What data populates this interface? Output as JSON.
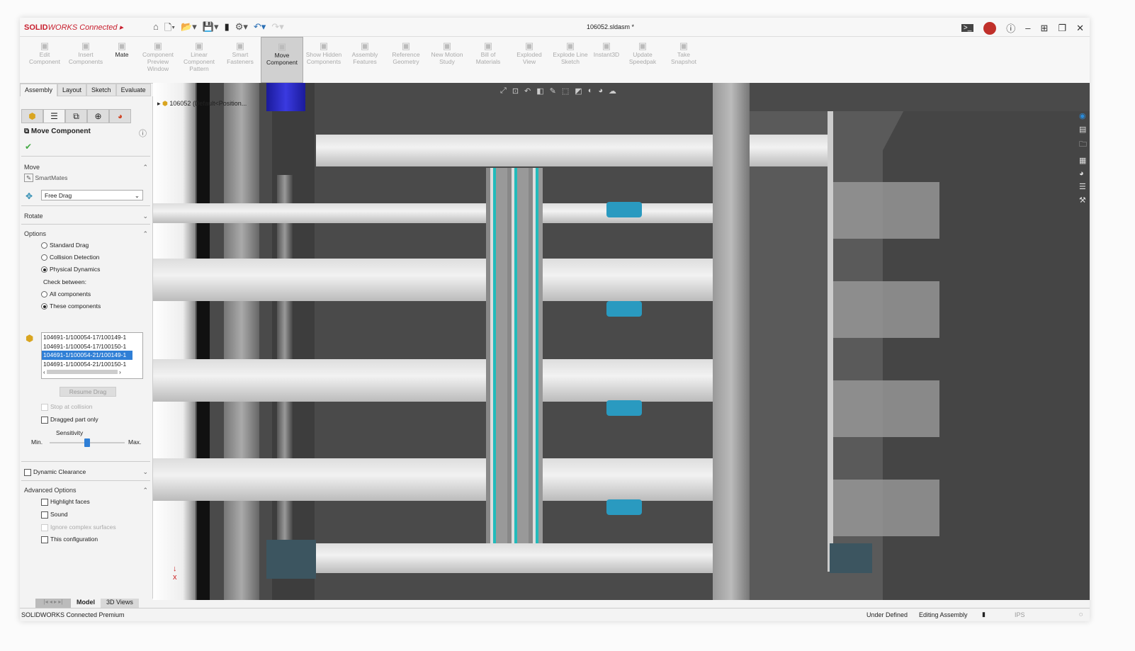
{
  "app": {
    "brand_bold": "SOLID",
    "brand_rest": "WORKS Connected",
    "document_title": "106052.sldasm *"
  },
  "quick_access": [
    "home-icon",
    "new-icon",
    "open-icon",
    "save-icon",
    "traffic-light-icon",
    "gear-icon",
    "undo-icon",
    "redo-icon"
  ],
  "ribbon": [
    {
      "label": "Edit Component",
      "state": "disabled"
    },
    {
      "label": "Insert Components",
      "state": "disabled"
    },
    {
      "label": "Mate",
      "state": "enabled"
    },
    {
      "label": "Component Preview Window",
      "state": "disabled"
    },
    {
      "label": "Linear Component Pattern",
      "state": "disabled"
    },
    {
      "label": "Smart Fasteners",
      "state": "disabled"
    },
    {
      "label": "Move Component",
      "state": "active"
    },
    {
      "label": "Show Hidden Components",
      "state": "disabled"
    },
    {
      "label": "Assembly Features",
      "state": "disabled"
    },
    {
      "label": "Reference Geometry",
      "state": "disabled"
    },
    {
      "label": "New Motion Study",
      "state": "disabled"
    },
    {
      "label": "Bill of Materials",
      "state": "disabled"
    },
    {
      "label": "Exploded View",
      "state": "disabled"
    },
    {
      "label": "Explode Line Sketch",
      "state": "disabled"
    },
    {
      "label": "Instant3D",
      "state": "disabled"
    },
    {
      "label": "Update Speedpak",
      "state": "disabled"
    },
    {
      "label": "Take Snapshot",
      "state": "disabled"
    }
  ],
  "command_tabs": [
    "Assembly",
    "Layout",
    "Sketch",
    "Evaluate"
  ],
  "property_manager": {
    "title": "Move Component",
    "move": {
      "heading": "Move",
      "smartmates": "SmartMates",
      "mode": "Free Drag"
    },
    "rotate": {
      "heading": "Rotate"
    },
    "options": {
      "heading": "Options",
      "radios": [
        "Standard Drag",
        "Collision Detection",
        "Physical Dynamics"
      ],
      "selected": "Physical Dynamics",
      "check_between": "Check between:",
      "check_radios": [
        "All components",
        "These components"
      ],
      "check_selected": "These components",
      "components": [
        "104691-1/100054-17/100149-1",
        "104691-1/100054-17/100150-1",
        "104691-1/100054-21/100149-1",
        "104691-1/100054-21/100150-1"
      ],
      "selected_component": "104691-1/100054-21/100149-1",
      "resume_drag": "Resume Drag",
      "stop_at_collision": "Stop at collision",
      "dragged_part_only": "Dragged part only",
      "sensitivity": "Sensitivity",
      "min": "Min.",
      "max": "Max.",
      "sensitivity_level": 0.5
    },
    "dynamic_clearance": "Dynamic Clearance",
    "advanced": {
      "heading": "Advanced Options",
      "items": [
        "Highlight faces",
        "Sound",
        "Ignore complex surfaces",
        "This configuration"
      ]
    }
  },
  "tree": {
    "root": "106052 (Default<Position..."
  },
  "bottom_tabs": [
    "Model",
    "3D Views"
  ],
  "status": {
    "left": "SOLIDWORKS Connected Premium",
    "state": "Under Defined",
    "mode": "Editing Assembly",
    "units": "IPS"
  },
  "colors": {
    "accent": "#2f7fd6",
    "brand": "#c8202f",
    "viewport": "#4a4a4a"
  }
}
